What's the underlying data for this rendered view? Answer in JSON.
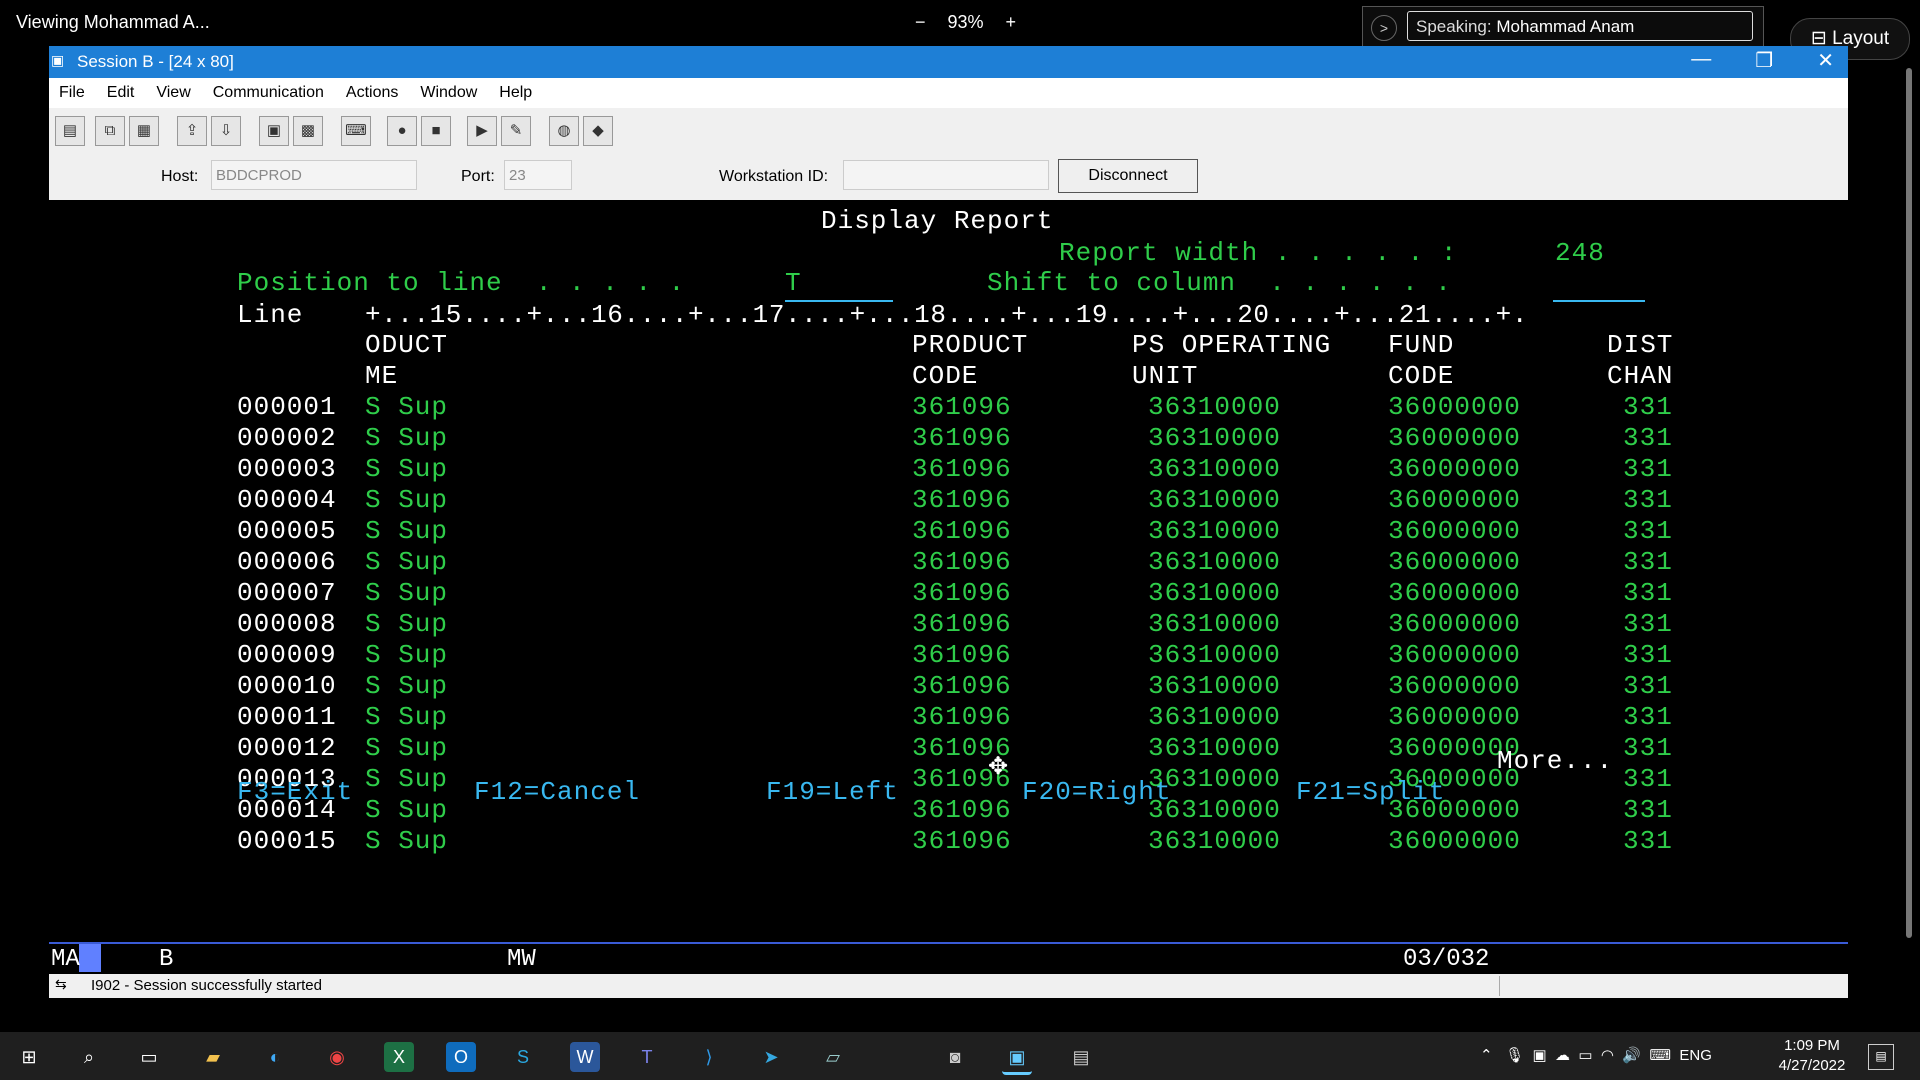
{
  "share": {
    "title": "Viewing Mohammad A...",
    "zoom_minus": "−",
    "zoom_level": "93%",
    "zoom_plus": "+",
    "speaking_label": "Speaking:",
    "speaking_name": "Mohammad Anam",
    "layout_label": "Layout"
  },
  "window": {
    "title": "Session B - [24 x 80]",
    "min": "—",
    "max": "❐",
    "close": "✕"
  },
  "menu": [
    "File",
    "Edit",
    "View",
    "Communication",
    "Actions",
    "Window",
    "Help"
  ],
  "hostbar": {
    "host_label": "Host:",
    "host_value": "BDDCPROD",
    "port_label": "Port:",
    "port_value": "23",
    "ws_label": "Workstation ID:",
    "ws_value": "",
    "disconnect_label": "Disconnect"
  },
  "terminal": {
    "title": "Display Report",
    "report_width_label": "Report width . . . . . :",
    "report_width_value": "248",
    "position_label": "Position to line  . . . . .",
    "position_value": "T",
    "shift_label": "Shift to column  . . . . . .",
    "ruler_label": "Line",
    "ruler": "+...15....+...16....+...17....+...18....+...19....+...20....+...21....+.",
    "headers": {
      "name1": "ODUCT",
      "name2": "ME",
      "prod1": "PRODUCT",
      "prod2": "CODE",
      "ps1": "PS OPERATING",
      "ps2": "UNIT",
      "fund1": "FUND",
      "fund2": "CODE",
      "dist1": "DIST",
      "dist2": "CHAN"
    },
    "rows": [
      {
        "line": "000001",
        "name": "S Sup",
        "product": "361096",
        "ps": "36310000",
        "fund": "36000000",
        "dist": "331"
      },
      {
        "line": "000002",
        "name": "S Sup",
        "product": "361096",
        "ps": "36310000",
        "fund": "36000000",
        "dist": "331"
      },
      {
        "line": "000003",
        "name": "S Sup",
        "product": "361096",
        "ps": "36310000",
        "fund": "36000000",
        "dist": "331"
      },
      {
        "line": "000004",
        "name": "S Sup",
        "product": "361096",
        "ps": "36310000",
        "fund": "36000000",
        "dist": "331"
      },
      {
        "line": "000005",
        "name": "S Sup",
        "product": "361096",
        "ps": "36310000",
        "fund": "36000000",
        "dist": "331"
      },
      {
        "line": "000006",
        "name": "S Sup",
        "product": "361096",
        "ps": "36310000",
        "fund": "36000000",
        "dist": "331"
      },
      {
        "line": "000007",
        "name": "S Sup",
        "product": "361096",
        "ps": "36310000",
        "fund": "36000000",
        "dist": "331"
      },
      {
        "line": "000008",
        "name": "S Sup",
        "product": "361096",
        "ps": "36310000",
        "fund": "36000000",
        "dist": "331"
      },
      {
        "line": "000009",
        "name": "S Sup",
        "product": "361096",
        "ps": "36310000",
        "fund": "36000000",
        "dist": "331"
      },
      {
        "line": "000010",
        "name": "S Sup",
        "product": "361096",
        "ps": "36310000",
        "fund": "36000000",
        "dist": "331"
      },
      {
        "line": "000011",
        "name": "S Sup",
        "product": "361096",
        "ps": "36310000",
        "fund": "36000000",
        "dist": "331"
      },
      {
        "line": "000012",
        "name": "S Sup",
        "product": "361096",
        "ps": "36310000",
        "fund": "36000000",
        "dist": "331"
      },
      {
        "line": "000013",
        "name": "S Sup",
        "product": "361096",
        "ps": "36310000",
        "fund": "36000000",
        "dist": "331"
      },
      {
        "line": "000014",
        "name": "S Sup",
        "product": "361096",
        "ps": "36310000",
        "fund": "36000000",
        "dist": "331"
      },
      {
        "line": "000015",
        "name": "S Sup",
        "product": "361096",
        "ps": "36310000",
        "fund": "36000000",
        "dist": "331"
      }
    ],
    "more": "More...",
    "fkeys": [
      "F3=Exit",
      "F12=Cancel",
      "F19=Left",
      "F20=Right",
      "F21=Split"
    ]
  },
  "oia": {
    "ma": "MA",
    "session": "B",
    "mw": "MW",
    "cursor_pos": "03/032"
  },
  "statusbar": {
    "message": "I902 - Session successfully started"
  },
  "taskbar": {
    "lang": "ENG",
    "time": "1:09 PM",
    "date": "4/27/2022"
  },
  "colors": {
    "titlebar": "#1e7fd6",
    "term_green": "#2fcd4a",
    "term_blue": "#39b8f0",
    "term_white": "#ffffff"
  }
}
